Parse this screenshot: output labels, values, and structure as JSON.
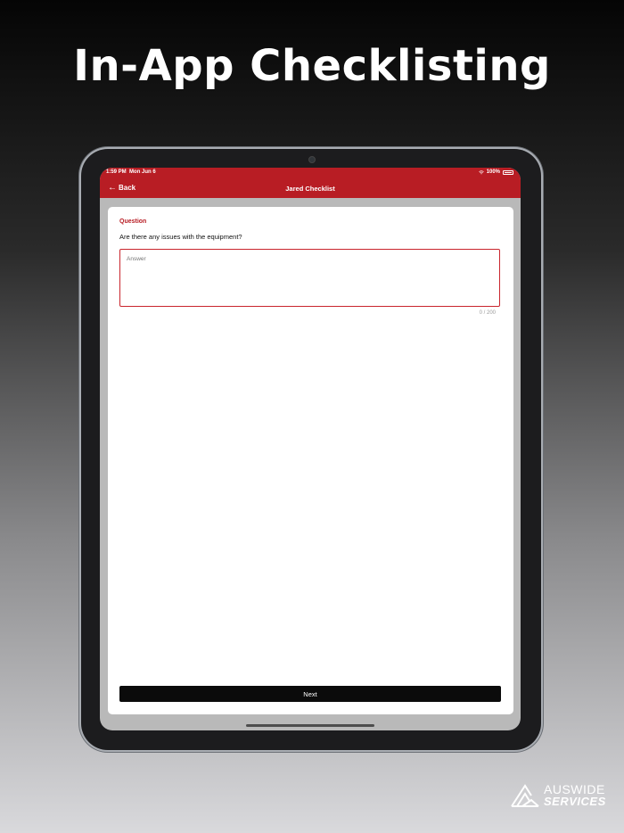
{
  "headline": "In-App Checklisting",
  "status_bar": {
    "time": "1:59 PM",
    "date": "Mon Jun 6",
    "battery": "100%"
  },
  "nav": {
    "back_label": "Back",
    "title": "Jared Checklist"
  },
  "question": {
    "label": "Question",
    "text": "Are there any issues with the equipment?"
  },
  "answer": {
    "placeholder": "Answer",
    "value": "",
    "counter": "0 / 200"
  },
  "next_label": "Next",
  "logo": {
    "line1": "AUSWIDE",
    "line2": "SERVICES"
  },
  "colors": {
    "brand_red": "#b81d24",
    "button_black": "#0b0b0b"
  }
}
